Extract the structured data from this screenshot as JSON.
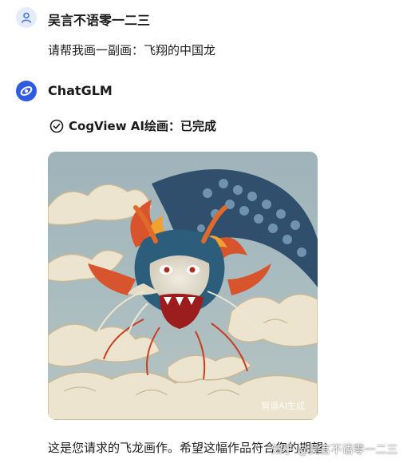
{
  "user": {
    "name": "吴言不语零一二三",
    "message": "请帮我画一副画：飞翔的中国龙"
  },
  "assistant": {
    "name": "ChatGLM",
    "status": "CogView AI绘画：已完成",
    "image_watermark": "智谱AI生成",
    "reply": "这是您请求的飞龙画作。希望这幅作品符合您的期望!"
  },
  "page_watermark": "知乎 @吴言不语零一二三",
  "colors": {
    "brand": "#2f5be0",
    "user_avatar_bg": "#e4ebfb",
    "user_avatar_icon": "#4a74e0"
  },
  "icons": {
    "user_avatar": "person-icon",
    "bot_avatar": "chatglm-logo-icon",
    "status": "check-circle-icon"
  }
}
